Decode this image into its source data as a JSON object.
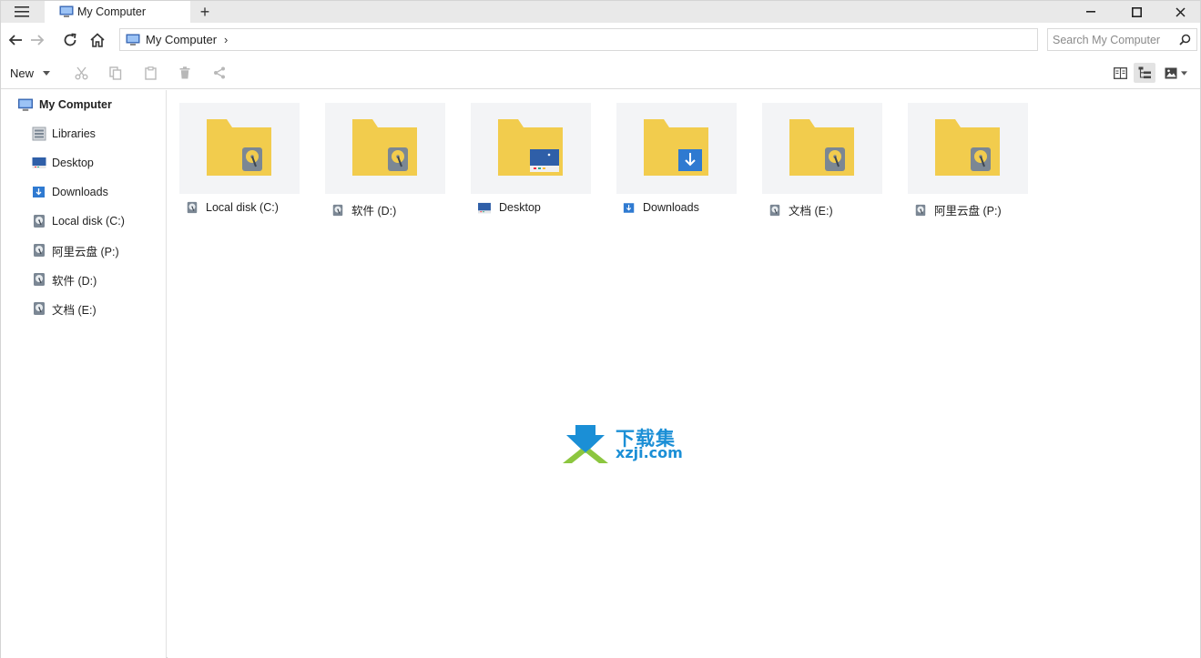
{
  "tab": {
    "title": "My Computer"
  },
  "address": {
    "crumbs": [
      "My Computer"
    ],
    "separator": "›"
  },
  "search": {
    "placeholder": "Search My Computer"
  },
  "toolbar": {
    "new_label": "New"
  },
  "sidebar": {
    "root": "My Computer",
    "items": [
      {
        "label": "Libraries",
        "icon": "library-icon"
      },
      {
        "label": "Desktop",
        "icon": "desktop-icon"
      },
      {
        "label": "Downloads",
        "icon": "downloads-icon"
      },
      {
        "label": "Local disk (C:)",
        "icon": "disk-icon"
      },
      {
        "label": "阿里云盘 (P:)",
        "icon": "disk-icon"
      },
      {
        "label": "软件 (D:)",
        "icon": "disk-icon"
      },
      {
        "label": "文档 (E:)",
        "icon": "disk-icon"
      }
    ]
  },
  "content": {
    "items": [
      {
        "label": "Local disk (C:)",
        "badge": "disk"
      },
      {
        "label": "软件 (D:)",
        "badge": "disk"
      },
      {
        "label": "Desktop",
        "badge": "desktop"
      },
      {
        "label": "Downloads",
        "badge": "download"
      },
      {
        "label": "文档 (E:)",
        "badge": "disk"
      },
      {
        "label": "阿里云盘 (P:)",
        "badge": "disk"
      }
    ]
  },
  "watermark": {
    "cn": "下载集",
    "en": "xzji.com"
  },
  "colors": {
    "folder": "#f2cc4d",
    "folder_tab": "#e8bd3a",
    "disk_badge": "#7b8794",
    "accent_blue": "#2f6fc7",
    "watermark_blue": "#1b8fd6",
    "watermark_green": "#8cc63f"
  }
}
